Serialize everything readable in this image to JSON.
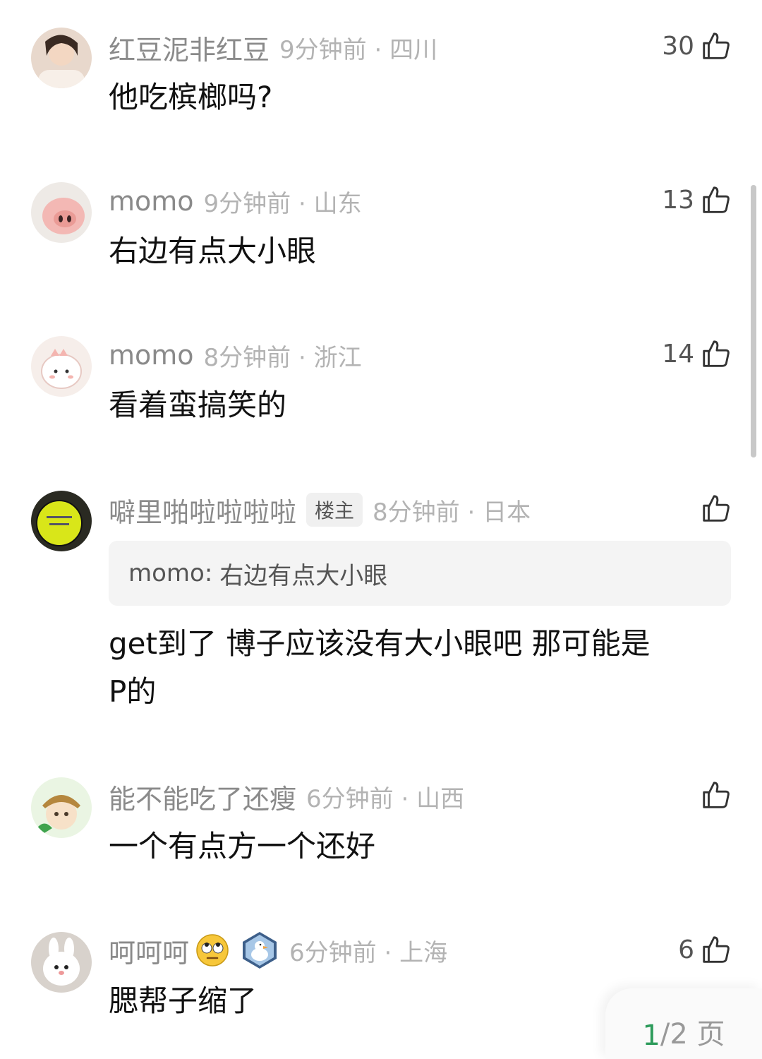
{
  "comments": [
    {
      "user": "红豆泥非红豆",
      "time": "9分钟前 · 四川",
      "likes": "30",
      "text": "他吃槟榔吗?"
    },
    {
      "user": "momo",
      "time": "9分钟前 · 山东",
      "likes": "13",
      "text": "右边有点大小眼"
    },
    {
      "user": "momo",
      "time": "8分钟前 · 浙江",
      "likes": "14",
      "text": "看着蛮搞笑的"
    },
    {
      "user": "噼里啪啦啦啦啦",
      "badge": "楼主",
      "time": "8分钟前 · 日本",
      "likes": "",
      "quote_user": "momo",
      "quote_sep": ":",
      "quote_text": "右边有点大小眼",
      "text_line1": "get到了 博子应该没有大小眼吧 那可能是",
      "text_line2": "P的"
    },
    {
      "user": "能不能吃了还瘦",
      "time": "6分钟前 · 山西",
      "likes": "",
      "text": "一个有点方一个还好"
    },
    {
      "user": "呵呵呵",
      "time": "6分钟前 · 上海",
      "likes": "6",
      "text": "腮帮子缩了",
      "user_emoji": "rolling-eyes-emoji",
      "user_badge_icon": "duck-badge-icon"
    }
  ],
  "pager": {
    "current": "1",
    "rest": "/2 页"
  },
  "colors": {
    "name": "#8a8a8a",
    "time": "#b3b3b3",
    "accent": "#2d9b5b"
  },
  "icons": {
    "like": "thumbs-up-icon"
  }
}
